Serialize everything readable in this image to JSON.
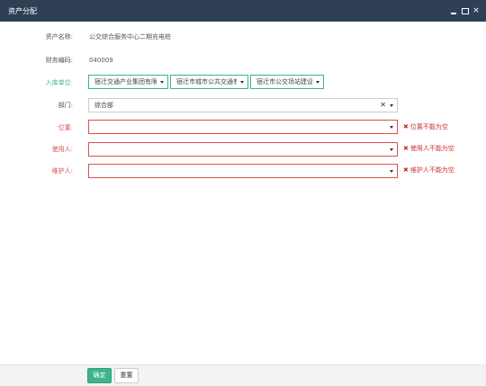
{
  "window": {
    "title": "资产分配",
    "minimize_icon": "minimize-icon",
    "maximize_icon": "maximize-icon",
    "close_icon": "close-icon",
    "close_glyph": "×"
  },
  "form": {
    "asset_name": {
      "label": "资产名称:",
      "value": "公交综合服务中心二期充电桩"
    },
    "finance_code": {
      "label": "财务编码:",
      "value": "040009"
    },
    "storage_unit": {
      "label": "入库单位:",
      "selects": [
        "宿迁交通产业集团有限公",
        "宿迁市城市公共交通有限",
        "宿迁市公交场站建设发"
      ]
    },
    "department": {
      "label": "部门:",
      "value": "综合部",
      "clear_glyph": "✕"
    },
    "location": {
      "label": "位置:",
      "value": "",
      "error": "位置不能为空"
    },
    "user": {
      "label": "使用人:",
      "value": "",
      "error": "使用人不能为空"
    },
    "maintainer": {
      "label": "维护人:",
      "value": "",
      "error": "维护人不能为空"
    }
  },
  "error_glyph": "✖",
  "footer": {
    "confirm_label": "确定",
    "reset_label": "重置"
  },
  "colors": {
    "titlebar": "#2f4056",
    "accent": "#3cb48c",
    "error": "#d9534f"
  }
}
